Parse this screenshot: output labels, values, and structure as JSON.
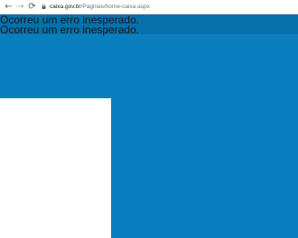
{
  "browser": {
    "url_domain": "caixa.gov.br",
    "url_path": "/Paginas/home-caixa.aspx",
    "icons": {
      "back": "arrow-left-icon",
      "forward": "arrow-right-icon",
      "reload": "reload-icon",
      "lock": "lock-icon"
    }
  },
  "page": {
    "error_messages": [
      "Ocorreu um erro inesperado.",
      "Ocorreu um erro inesperado."
    ],
    "colors": {
      "background": "#0a7fc0",
      "panel": "#ffffff"
    }
  }
}
